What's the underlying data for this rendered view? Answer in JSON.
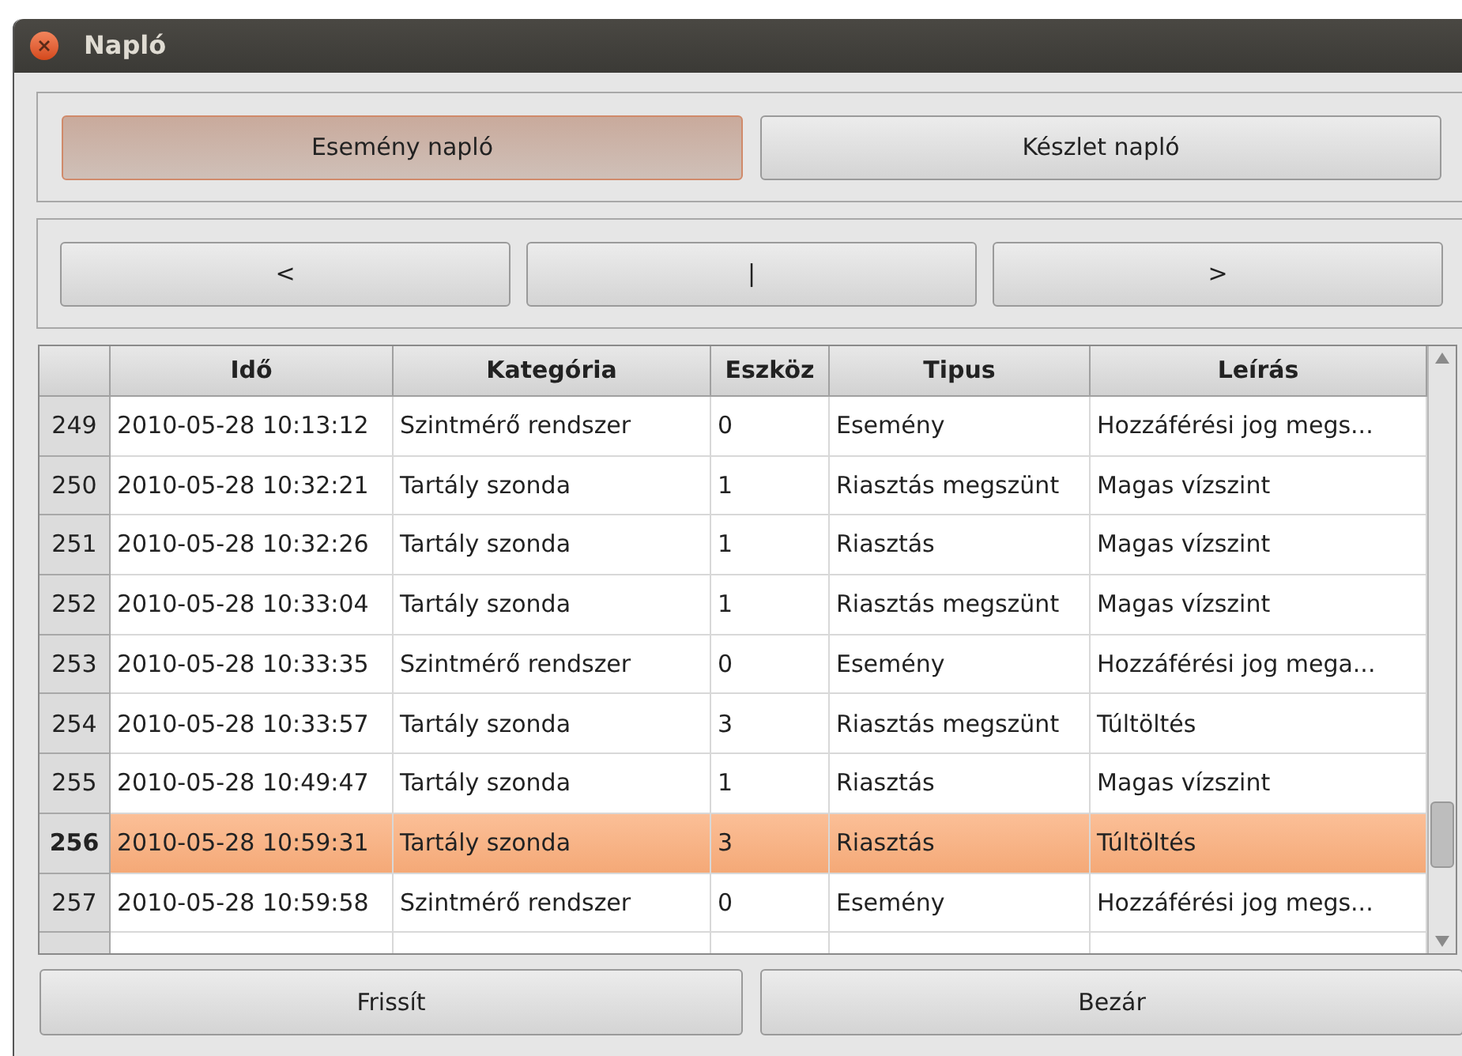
{
  "window": {
    "title": "Napló"
  },
  "log_tabs": [
    {
      "label": "Esemény napló",
      "selected": true
    },
    {
      "label": "Készlet napló",
      "selected": false
    }
  ],
  "nav_buttons": [
    "<",
    "|",
    ">"
  ],
  "table": {
    "columns": [
      "Idő",
      "Kategória",
      "Eszköz",
      "Tipus",
      "Leírás"
    ],
    "rows": [
      {
        "number": "249",
        "cells": [
          "2010-05-28 10:13:12",
          "Szintmérő rendszer",
          "0",
          "Esemény",
          "Hozzáférési jog megs..."
        ],
        "selected": false
      },
      {
        "number": "250",
        "cells": [
          "2010-05-28 10:32:21",
          "Tartály szonda",
          "1",
          "Riasztás megszünt",
          "Magas vízszint"
        ],
        "selected": false
      },
      {
        "number": "251",
        "cells": [
          "2010-05-28 10:32:26",
          "Tartály szonda",
          "1",
          "Riasztás",
          "Magas vízszint"
        ],
        "selected": false
      },
      {
        "number": "252",
        "cells": [
          "2010-05-28 10:33:04",
          "Tartály szonda",
          "1",
          "Riasztás megszünt",
          "Magas vízszint"
        ],
        "selected": false
      },
      {
        "number": "253",
        "cells": [
          "2010-05-28 10:33:35",
          "Szintmérő rendszer",
          "0",
          "Esemény",
          "Hozzáférési jog mega..."
        ],
        "selected": false
      },
      {
        "number": "254",
        "cells": [
          "2010-05-28 10:33:57",
          "Tartály szonda",
          "3",
          "Riasztás megszünt",
          "Túltöltés"
        ],
        "selected": false
      },
      {
        "number": "255",
        "cells": [
          "2010-05-28 10:49:47",
          "Tartály szonda",
          "1",
          "Riasztás",
          "Magas vízszint"
        ],
        "selected": false
      },
      {
        "number": "256",
        "cells": [
          "2010-05-28 10:59:31",
          "Tartály szonda",
          "3",
          "Riasztás",
          "Túltöltés"
        ],
        "selected": true
      },
      {
        "number": "257",
        "cells": [
          "2010-05-28 10:59:58",
          "Szintmérő rendszer",
          "0",
          "Esemény",
          "Hozzáférési jog megs..."
        ],
        "selected": false
      }
    ]
  },
  "footer_buttons": [
    "Frissít",
    "Bezár"
  ]
}
